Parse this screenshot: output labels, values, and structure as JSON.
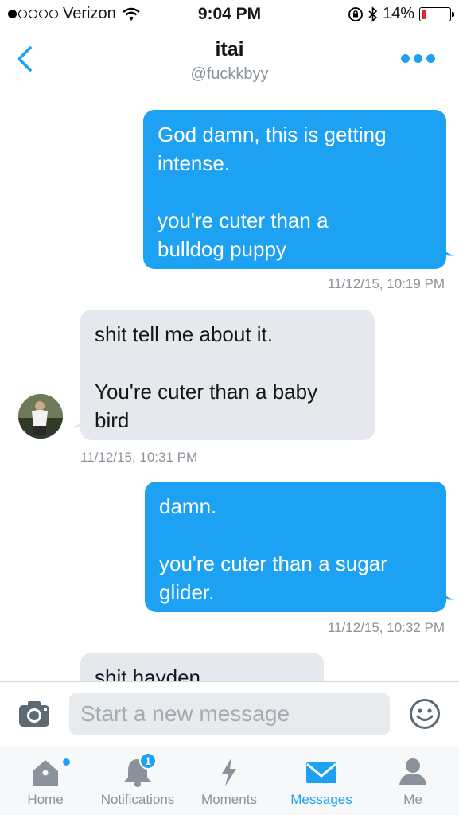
{
  "status_bar": {
    "carrier": "Verizon",
    "time": "9:04 PM",
    "battery": "14%",
    "battery_level": 0.14
  },
  "header": {
    "title": "itai",
    "subtitle": "@fuckkbyy"
  },
  "messages": [
    {
      "direction": "out",
      "text": "God damn, this is getting\nintense.\n\nyou're cuter than a\nbulldog puppy",
      "timestamp": "11/12/15, 10:19 PM"
    },
    {
      "direction": "in",
      "text": "shit tell me about it.\n\nYou're cuter than a baby\nbird",
      "timestamp": "11/12/15, 10:31 PM"
    },
    {
      "direction": "out",
      "text": "damn.\n\nyou're cuter than a sugar\nglider.",
      "timestamp": "11/12/15, 10:32 PM"
    },
    {
      "direction": "in",
      "text": "shit hayden",
      "timestamp": ""
    }
  ],
  "composer": {
    "placeholder": "Start a new message"
  },
  "tabs": [
    {
      "label": "Home",
      "icon": "home-icon"
    },
    {
      "label": "Notifications",
      "icon": "bell-icon",
      "badge": "1"
    },
    {
      "label": "Moments",
      "icon": "lightning-icon"
    },
    {
      "label": "Messages",
      "icon": "envelope-icon",
      "active": true
    },
    {
      "label": "Me",
      "icon": "person-icon"
    }
  ],
  "colors": {
    "accent": "#1da1f2",
    "incoming_bubble": "#e5e9ed",
    "muted_text": "#8a939b"
  }
}
